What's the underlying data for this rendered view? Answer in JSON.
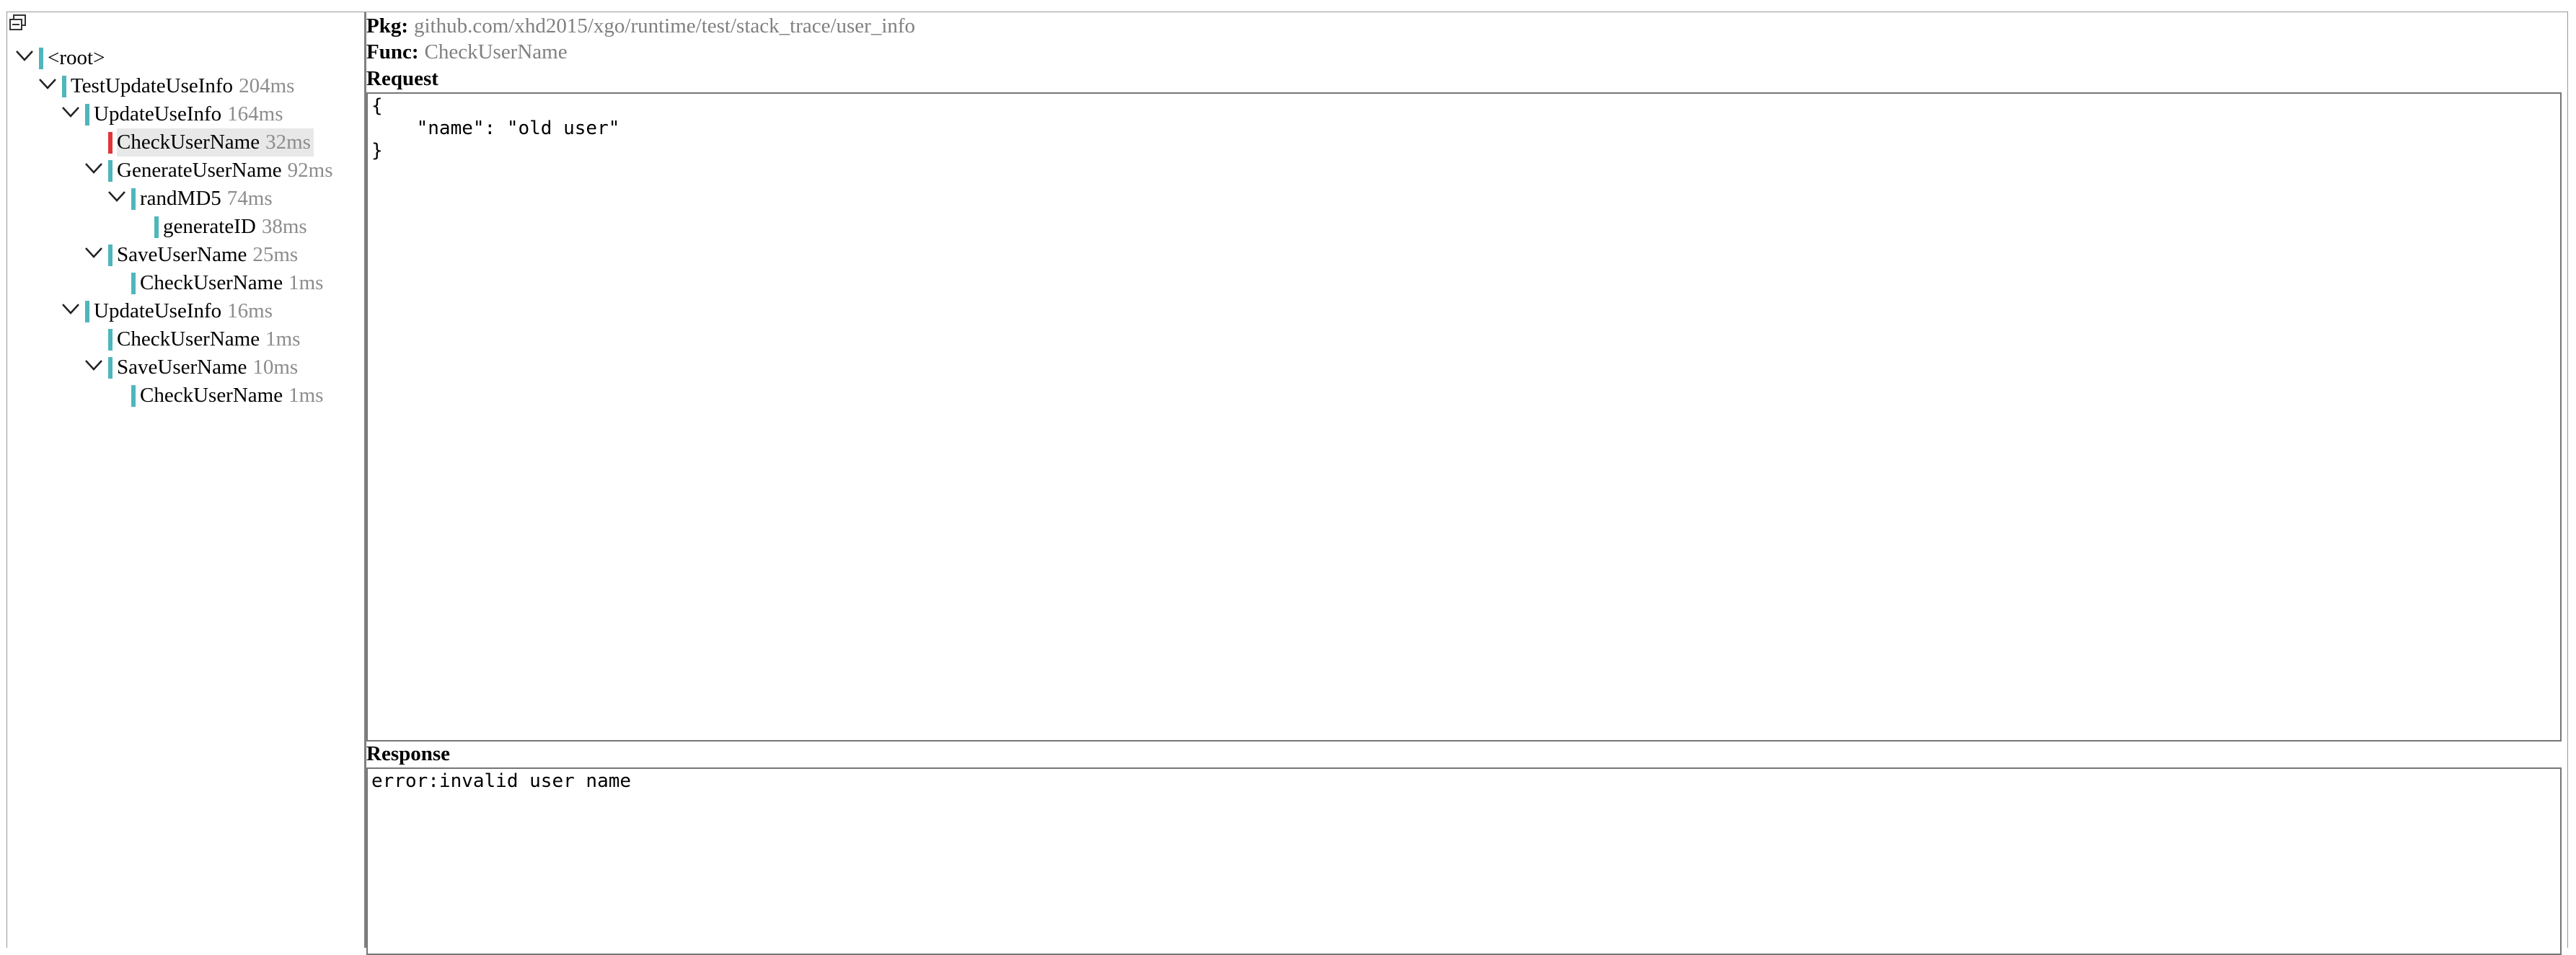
{
  "tree": {
    "collapse_all_icon": "collapse-all-icon",
    "nodes": [
      {
        "name": "<root>",
        "duration": "",
        "depth": 0,
        "expanded": true,
        "has_children": true,
        "status": "ok"
      },
      {
        "name": "TestUpdateUseInfo",
        "duration": "204ms",
        "depth": 1,
        "expanded": true,
        "has_children": true,
        "status": "ok"
      },
      {
        "name": "UpdateUseInfo",
        "duration": "164ms",
        "depth": 2,
        "expanded": true,
        "has_children": true,
        "status": "ok"
      },
      {
        "name": "CheckUserName",
        "duration": "32ms",
        "depth": 3,
        "expanded": false,
        "has_children": false,
        "status": "error",
        "selected": true
      },
      {
        "name": "GenerateUserName",
        "duration": "92ms",
        "depth": 3,
        "expanded": true,
        "has_children": true,
        "status": "ok"
      },
      {
        "name": "randMD5",
        "duration": "74ms",
        "depth": 4,
        "expanded": true,
        "has_children": true,
        "status": "ok"
      },
      {
        "name": "generateID",
        "duration": "38ms",
        "depth": 5,
        "expanded": false,
        "has_children": false,
        "status": "ok"
      },
      {
        "name": "SaveUserName",
        "duration": "25ms",
        "depth": 3,
        "expanded": true,
        "has_children": true,
        "status": "ok"
      },
      {
        "name": "CheckUserName",
        "duration": "1ms",
        "depth": 4,
        "expanded": false,
        "has_children": false,
        "status": "ok"
      },
      {
        "name": "UpdateUseInfo",
        "duration": "16ms",
        "depth": 2,
        "expanded": true,
        "has_children": true,
        "status": "ok"
      },
      {
        "name": "CheckUserName",
        "duration": "1ms",
        "depth": 3,
        "expanded": false,
        "has_children": false,
        "status": "ok"
      },
      {
        "name": "SaveUserName",
        "duration": "10ms",
        "depth": 3,
        "expanded": true,
        "has_children": true,
        "status": "ok"
      },
      {
        "name": "CheckUserName",
        "duration": "1ms",
        "depth": 4,
        "expanded": false,
        "has_children": false,
        "status": "ok"
      }
    ]
  },
  "detail": {
    "pkg_label": "Pkg:",
    "pkg_value": "github.com/xhd2015/xgo/runtime/test/stack_trace/user_info",
    "func_label": "Func:",
    "func_value": "CheckUserName",
    "request_title": "Request",
    "request_body": "{\n    \"name\": \"old user\"\n}",
    "response_title": "Response",
    "response_body": "error:invalid user name"
  },
  "colors": {
    "ok_bar": "#4fb6bc",
    "error_bar": "#e0353a",
    "duration_text": "#8c8c8c",
    "selected_bg": "#e8e8e8"
  }
}
